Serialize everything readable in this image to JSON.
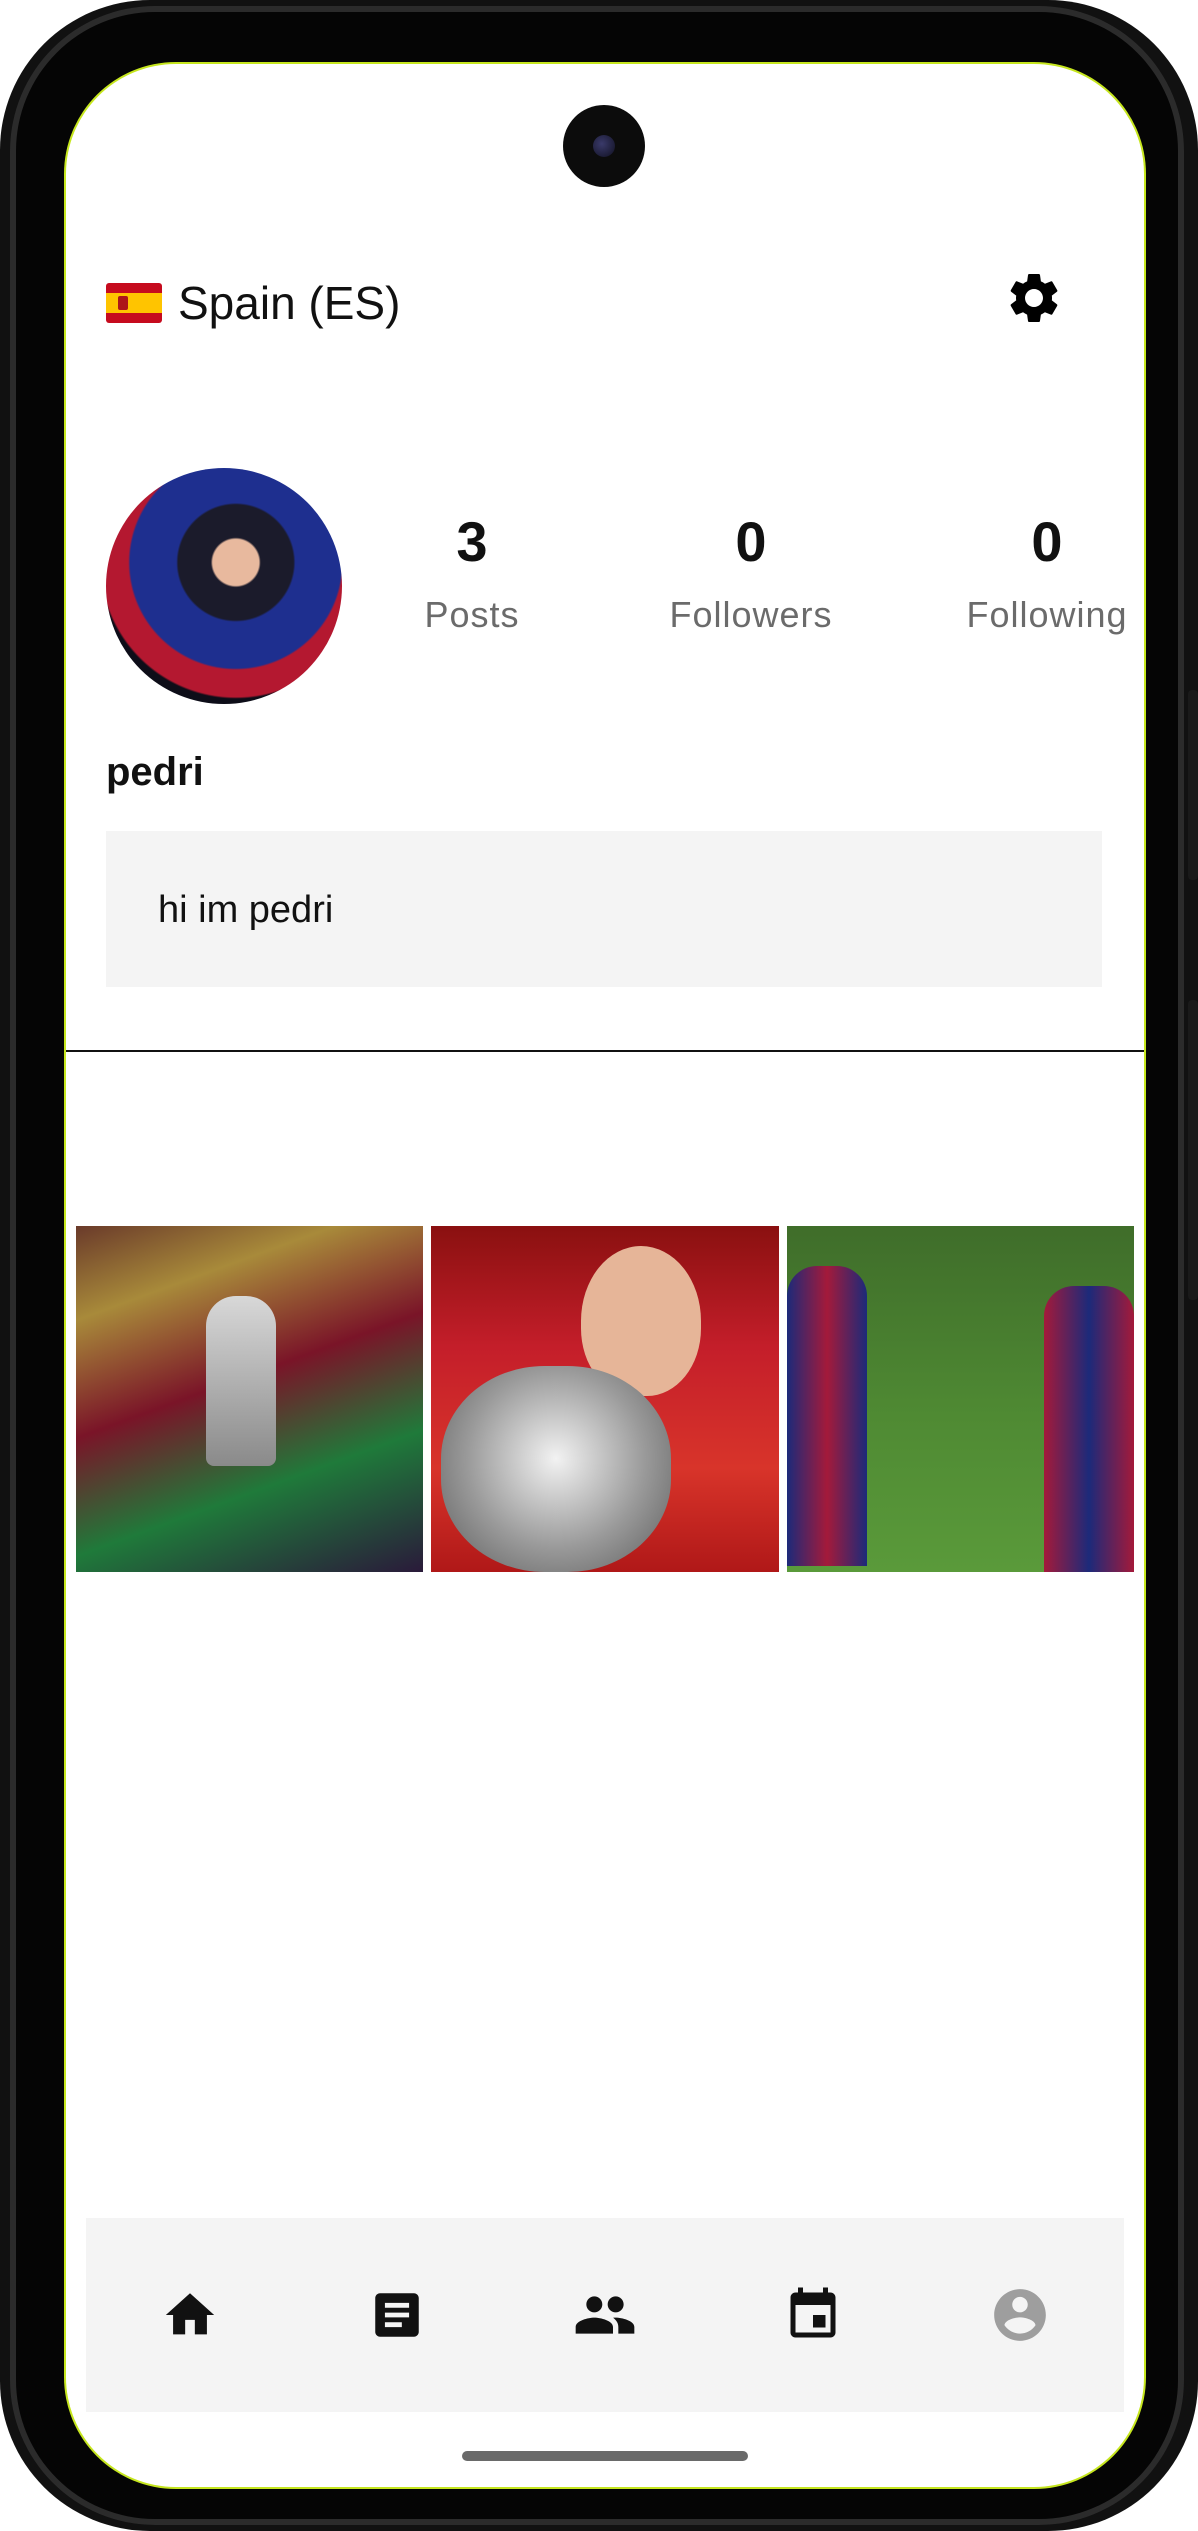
{
  "header": {
    "country_label": "Spain (ES)"
  },
  "profile": {
    "username": "pedri",
    "bio": "hi im pedri",
    "stats": [
      {
        "value": "3",
        "label": "Posts"
      },
      {
        "value": "0",
        "label": "Followers"
      },
      {
        "value": "0",
        "label": "Following"
      }
    ]
  },
  "posts": [
    {
      "description": "team-trophy-celebration"
    },
    {
      "description": "player-with-trophy"
    },
    {
      "description": "players-celebrating-on-pitch"
    }
  ],
  "bottom_nav": {
    "items": [
      {
        "icon": "home-icon"
      },
      {
        "icon": "article-icon"
      },
      {
        "icon": "people-icon"
      },
      {
        "icon": "calendar-icon"
      },
      {
        "icon": "account-icon"
      }
    ]
  },
  "colors": {
    "accent_border": "#c6e61e",
    "bio_background": "#f4f4f4",
    "nav_background": "#f4f4f4",
    "inactive_icon": "#9e9e9e"
  }
}
